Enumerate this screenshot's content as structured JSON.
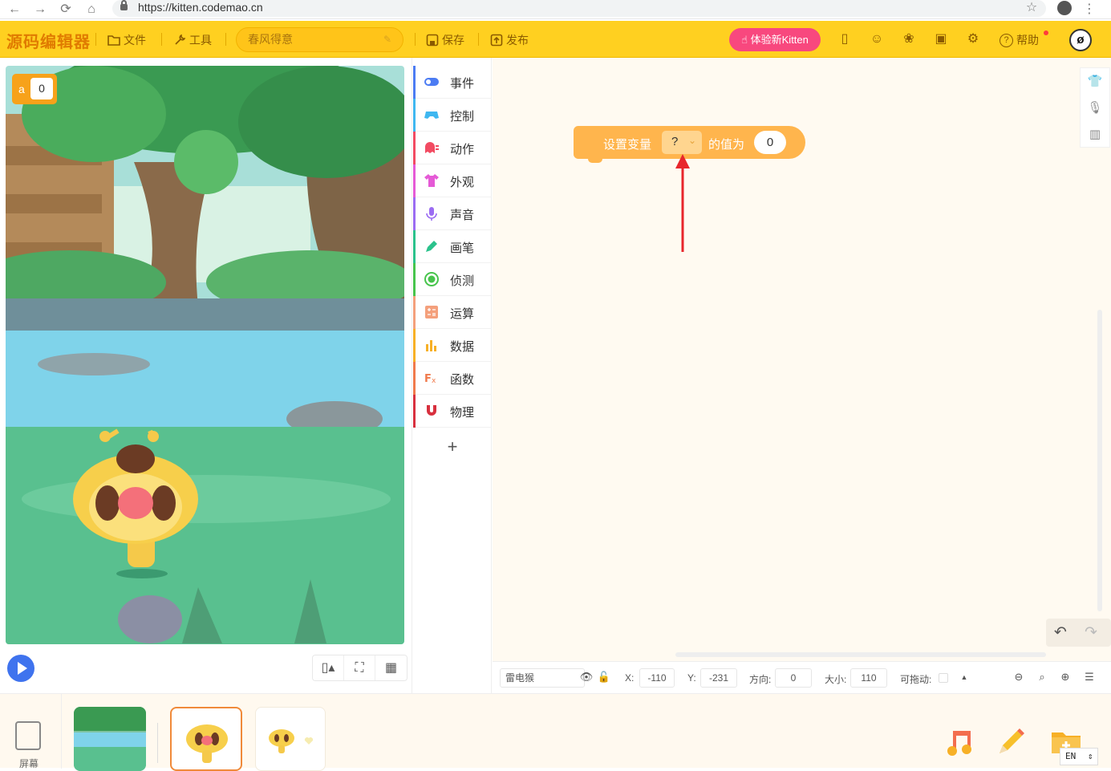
{
  "browser": {
    "url": "https://kitten.codemao.cn",
    "back_icon": "←",
    "forward_icon": "→",
    "reload_icon": "⟳",
    "home_icon": "⌂",
    "star_icon": "☆",
    "menu_icon": "⋮"
  },
  "toolbar": {
    "logo": "源码编辑器",
    "file": "文件",
    "tools": "工具",
    "project_name": "春风得意",
    "save": "保存",
    "publish": "发布",
    "try_kitten": "体验新Kitten",
    "help": "帮助"
  },
  "stage": {
    "variable": {
      "name": "a",
      "value": "0"
    }
  },
  "categories": [
    {
      "label": "事件",
      "color": "#4c7cf3"
    },
    {
      "label": "控制",
      "color": "#3fb7f0"
    },
    {
      "label": "动作",
      "color": "#f24b62"
    },
    {
      "label": "外观",
      "color": "#e55ad6"
    },
    {
      "label": "声音",
      "color": "#9b6cf2"
    },
    {
      "label": "画笔",
      "color": "#2bc28c"
    },
    {
      "label": "侦测",
      "color": "#47c44c"
    },
    {
      "label": "运算",
      "color": "#f4a07c"
    },
    {
      "label": "数据",
      "color": "#f7b026"
    },
    {
      "label": "函数",
      "color": "#f07a4c"
    },
    {
      "label": "物理",
      "color": "#d8303e"
    }
  ],
  "add_category": "+",
  "block": {
    "label": "设置变量",
    "dropdown": "?",
    "middle": "的值为",
    "value": "0"
  },
  "properties": {
    "sprite_name": "雷电猴",
    "x_label": "X:",
    "x": "-110",
    "y_label": "Y:",
    "y": "-231",
    "dir_label": "方向:",
    "dir": "0",
    "size_label": "大小:",
    "size": "110",
    "drag_label": "可拖动:"
  },
  "bottom": {
    "screen_label": "屏幕",
    "ime": "EN"
  },
  "colors": {
    "accent": "#ffd020",
    "block": "#ffb54d",
    "try_button": "#f8487e",
    "play": "#3f73ee"
  }
}
